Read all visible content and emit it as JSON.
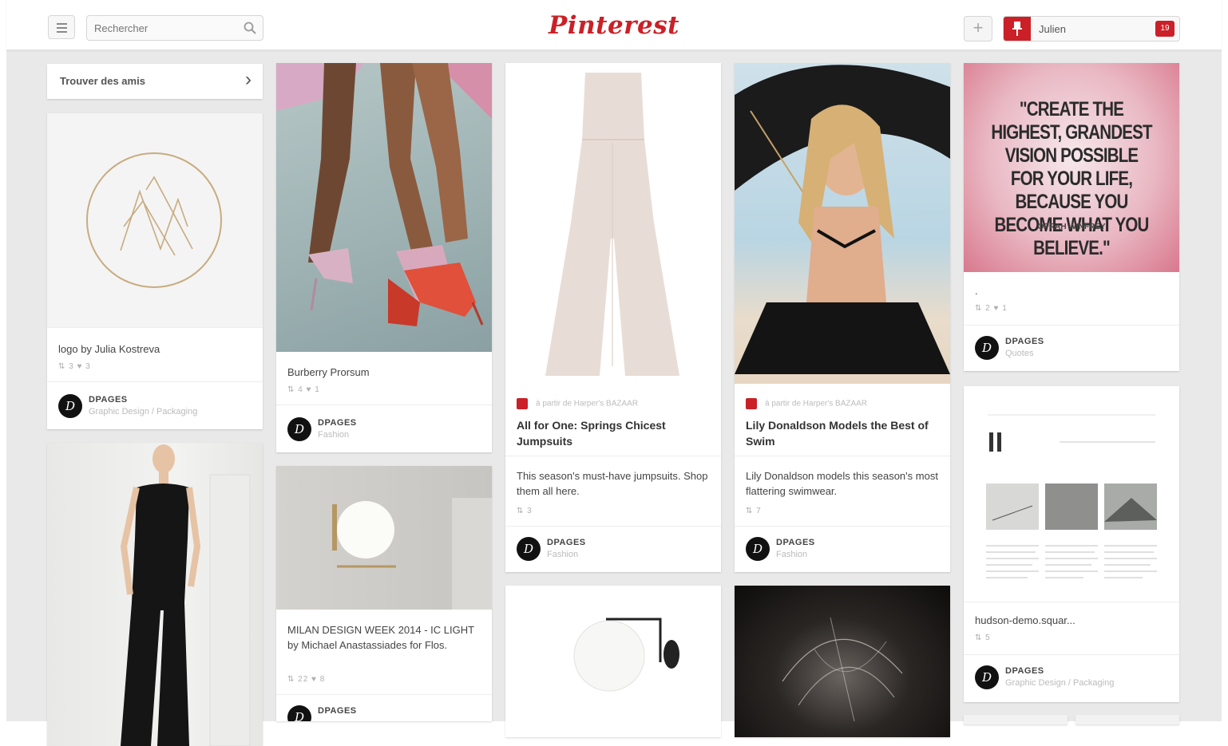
{
  "header": {
    "search_placeholder": "Rechercher",
    "logo": "Pinterest",
    "add_symbol": "+",
    "user_name": "Julien",
    "notification_count": "19"
  },
  "find_friends": {
    "label": "Trouver des amis",
    "chevron": "›"
  },
  "pins": {
    "logo_julia": {
      "description": "logo by Julia Kostreva",
      "meta": "⇅ 3   ♥ 3",
      "board_owner": "DPAGES",
      "board_name": "Graphic Design / Packaging"
    },
    "burberry": {
      "description": "Burberry Prorsum",
      "meta": "⇅ 4   ♥ 1",
      "board_owner": "DPAGES",
      "board_name": "Fashion"
    },
    "milan": {
      "description": "MILAN DESIGN WEEK 2014 - IC LIGHT by Michael Anastassiades for Flos.",
      "meta": "⇅ 22   ♥ 8",
      "board_owner": "DPAGES"
    },
    "jumpsuits": {
      "via": "à partir de Harper's BAZAAR",
      "title": "All for One: Springs Chicest Jumpsuits",
      "description": "This season's must-have jumpsuits. Shop them all here.",
      "meta": "⇅ 3",
      "board_owner": "DPAGES",
      "board_name": "Fashion"
    },
    "lily": {
      "via": "à partir de Harper's BAZAAR",
      "title": "Lily Donaldson Models the Best of Swim",
      "description": "Lily Donaldson models this season's most flattering swimwear.",
      "meta": "⇅ 7",
      "board_owner": "DPAGES",
      "board_name": "Fashion"
    },
    "quote": {
      "quote_text": "\"CREATE THE HIGHEST, GRANDEST VISION POSSIBLE FOR YOUR LIFE, BECAUSE YOU BECOME WHAT YOU BELIEVE.\"",
      "author": "OPRAH WINFREY",
      "description": ".",
      "meta": "⇅ 2   ♥ 1",
      "board_owner": "DPAGES",
      "board_name": "Quotes"
    },
    "hudson": {
      "description": "hudson-demo.squar...",
      "meta": "⇅ 5",
      "board_owner": "DPAGES",
      "board_name": "Graphic Design / Packaging"
    }
  },
  "colors": {
    "brand": "#cb2027",
    "background": "#e9e9e9"
  }
}
